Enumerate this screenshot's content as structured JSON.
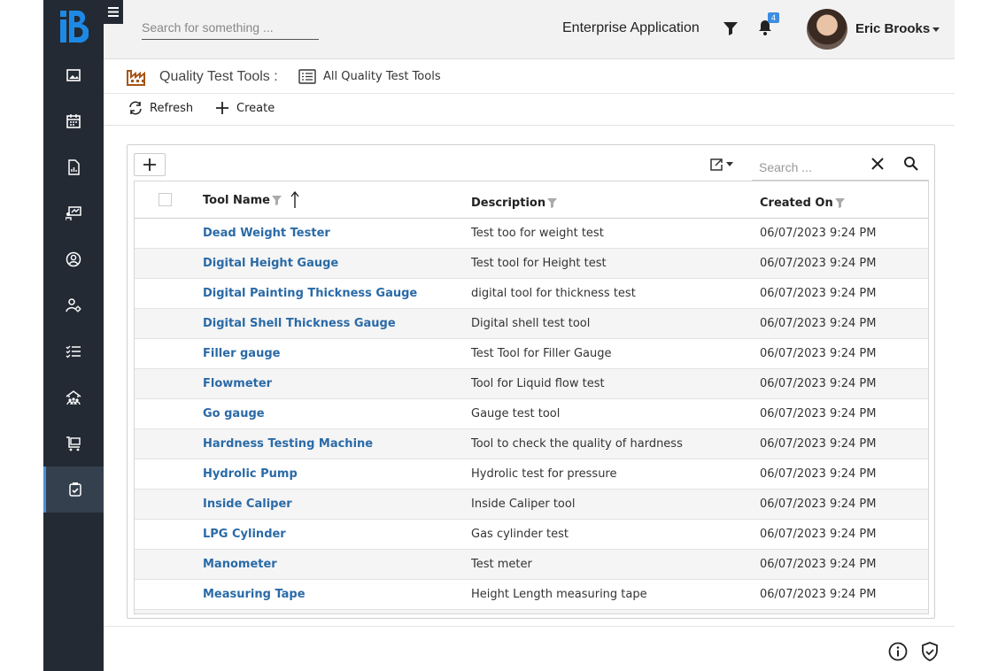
{
  "header": {
    "search_placeholder": "Search for something ...",
    "app_name": "Enterprise Application",
    "notification_count": "4",
    "user_name": "Eric Brooks"
  },
  "breadcrumb": {
    "title": "Quality Test Tools :",
    "view": "All Quality Test Tools"
  },
  "toolbar": {
    "refresh_label": "Refresh",
    "create_label": "Create"
  },
  "grid": {
    "search_placeholder": "Search ...",
    "columns": [
      "Tool Name",
      "Description",
      "Created On"
    ],
    "rows": [
      {
        "name": "Dead Weight Tester",
        "desc": "Test too for weight test",
        "date": "06/07/2023 9:24 PM"
      },
      {
        "name": "Digital Height Gauge",
        "desc": "Test tool for Height test",
        "date": "06/07/2023 9:24 PM"
      },
      {
        "name": "Digital Painting Thickness Gauge",
        "desc": "digital tool for thickness test",
        "date": "06/07/2023 9:24 PM"
      },
      {
        "name": "Digital Shell Thickness Gauge",
        "desc": "Digital shell test tool",
        "date": "06/07/2023 9:24 PM"
      },
      {
        "name": "Filler gauge",
        "desc": "Test Tool for Filler Gauge",
        "date": "06/07/2023 9:24 PM"
      },
      {
        "name": "Flowmeter",
        "desc": "Tool for Liquid flow test",
        "date": "06/07/2023 9:24 PM"
      },
      {
        "name": "Go gauge",
        "desc": "Gauge test tool",
        "date": "06/07/2023 9:24 PM"
      },
      {
        "name": "Hardness Testing Machine",
        "desc": "Tool to check the quality of hardness",
        "date": "06/07/2023 9:24 PM"
      },
      {
        "name": "Hydrolic Pump",
        "desc": "Hydrolic test for pressure",
        "date": "06/07/2023 9:24 PM"
      },
      {
        "name": "Inside Caliper",
        "desc": "Inside Caliper tool",
        "date": "06/07/2023 9:24 PM"
      },
      {
        "name": "LPG Cylinder",
        "desc": "Gas cylinder test",
        "date": "06/07/2023 9:24 PM"
      },
      {
        "name": "Manometer",
        "desc": "Test meter",
        "date": "06/07/2023 9:24 PM"
      },
      {
        "name": "Measuring Tape",
        "desc": "Height Length measuring tape",
        "date": "06/07/2023 9:24 PM"
      }
    ]
  },
  "sidebar": {
    "items": [
      "image-icon",
      "calendar-icon",
      "report-icon",
      "presentation-icon",
      "user-circle-icon",
      "user-settings-icon",
      "checklist-icon",
      "warehouse-icon",
      "cart-icon",
      "clipboard-check-icon"
    ]
  },
  "colors": {
    "sidebar": "#232a33",
    "link": "#2a6aa7",
    "accent": "#4c8fd6",
    "brand": "#1e88e5"
  }
}
